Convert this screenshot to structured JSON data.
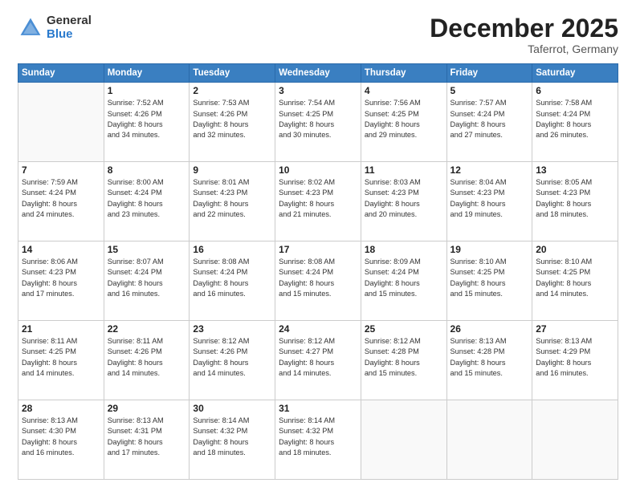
{
  "logo": {
    "general": "General",
    "blue": "Blue"
  },
  "header": {
    "month": "December 2025",
    "location": "Taferrot, Germany"
  },
  "weekdays": [
    "Sunday",
    "Monday",
    "Tuesday",
    "Wednesday",
    "Thursday",
    "Friday",
    "Saturday"
  ],
  "weeks": [
    [
      {
        "day": null
      },
      {
        "day": 1,
        "sunrise": "7:52 AM",
        "sunset": "4:26 PM",
        "daylight": "8 hours and 34 minutes."
      },
      {
        "day": 2,
        "sunrise": "7:53 AM",
        "sunset": "4:26 PM",
        "daylight": "8 hours and 32 minutes."
      },
      {
        "day": 3,
        "sunrise": "7:54 AM",
        "sunset": "4:25 PM",
        "daylight": "8 hours and 30 minutes."
      },
      {
        "day": 4,
        "sunrise": "7:56 AM",
        "sunset": "4:25 PM",
        "daylight": "8 hours and 29 minutes."
      },
      {
        "day": 5,
        "sunrise": "7:57 AM",
        "sunset": "4:24 PM",
        "daylight": "8 hours and 27 minutes."
      },
      {
        "day": 6,
        "sunrise": "7:58 AM",
        "sunset": "4:24 PM",
        "daylight": "8 hours and 26 minutes."
      }
    ],
    [
      {
        "day": 7,
        "sunrise": "7:59 AM",
        "sunset": "4:24 PM",
        "daylight": "8 hours and 24 minutes."
      },
      {
        "day": 8,
        "sunrise": "8:00 AM",
        "sunset": "4:24 PM",
        "daylight": "8 hours and 23 minutes."
      },
      {
        "day": 9,
        "sunrise": "8:01 AM",
        "sunset": "4:23 PM",
        "daylight": "8 hours and 22 minutes."
      },
      {
        "day": 10,
        "sunrise": "8:02 AM",
        "sunset": "4:23 PM",
        "daylight": "8 hours and 21 minutes."
      },
      {
        "day": 11,
        "sunrise": "8:03 AM",
        "sunset": "4:23 PM",
        "daylight": "8 hours and 20 minutes."
      },
      {
        "day": 12,
        "sunrise": "8:04 AM",
        "sunset": "4:23 PM",
        "daylight": "8 hours and 19 minutes."
      },
      {
        "day": 13,
        "sunrise": "8:05 AM",
        "sunset": "4:23 PM",
        "daylight": "8 hours and 18 minutes."
      }
    ],
    [
      {
        "day": 14,
        "sunrise": "8:06 AM",
        "sunset": "4:23 PM",
        "daylight": "8 hours and 17 minutes."
      },
      {
        "day": 15,
        "sunrise": "8:07 AM",
        "sunset": "4:24 PM",
        "daylight": "8 hours and 16 minutes."
      },
      {
        "day": 16,
        "sunrise": "8:08 AM",
        "sunset": "4:24 PM",
        "daylight": "8 hours and 16 minutes."
      },
      {
        "day": 17,
        "sunrise": "8:08 AM",
        "sunset": "4:24 PM",
        "daylight": "8 hours and 15 minutes."
      },
      {
        "day": 18,
        "sunrise": "8:09 AM",
        "sunset": "4:24 PM",
        "daylight": "8 hours and 15 minutes."
      },
      {
        "day": 19,
        "sunrise": "8:10 AM",
        "sunset": "4:25 PM",
        "daylight": "8 hours and 15 minutes."
      },
      {
        "day": 20,
        "sunrise": "8:10 AM",
        "sunset": "4:25 PM",
        "daylight": "8 hours and 14 minutes."
      }
    ],
    [
      {
        "day": 21,
        "sunrise": "8:11 AM",
        "sunset": "4:25 PM",
        "daylight": "8 hours and 14 minutes."
      },
      {
        "day": 22,
        "sunrise": "8:11 AM",
        "sunset": "4:26 PM",
        "daylight": "8 hours and 14 minutes."
      },
      {
        "day": 23,
        "sunrise": "8:12 AM",
        "sunset": "4:26 PM",
        "daylight": "8 hours and 14 minutes."
      },
      {
        "day": 24,
        "sunrise": "8:12 AM",
        "sunset": "4:27 PM",
        "daylight": "8 hours and 14 minutes."
      },
      {
        "day": 25,
        "sunrise": "8:12 AM",
        "sunset": "4:28 PM",
        "daylight": "8 hours and 15 minutes."
      },
      {
        "day": 26,
        "sunrise": "8:13 AM",
        "sunset": "4:28 PM",
        "daylight": "8 hours and 15 minutes."
      },
      {
        "day": 27,
        "sunrise": "8:13 AM",
        "sunset": "4:29 PM",
        "daylight": "8 hours and 16 minutes."
      }
    ],
    [
      {
        "day": 28,
        "sunrise": "8:13 AM",
        "sunset": "4:30 PM",
        "daylight": "8 hours and 16 minutes."
      },
      {
        "day": 29,
        "sunrise": "8:13 AM",
        "sunset": "4:31 PM",
        "daylight": "8 hours and 17 minutes."
      },
      {
        "day": 30,
        "sunrise": "8:14 AM",
        "sunset": "4:32 PM",
        "daylight": "8 hours and 18 minutes."
      },
      {
        "day": 31,
        "sunrise": "8:14 AM",
        "sunset": "4:32 PM",
        "daylight": "8 hours and 18 minutes."
      },
      {
        "day": null
      },
      {
        "day": null
      },
      {
        "day": null
      }
    ]
  ],
  "labels": {
    "sunrise": "Sunrise:",
    "sunset": "Sunset:",
    "daylight": "Daylight:"
  }
}
